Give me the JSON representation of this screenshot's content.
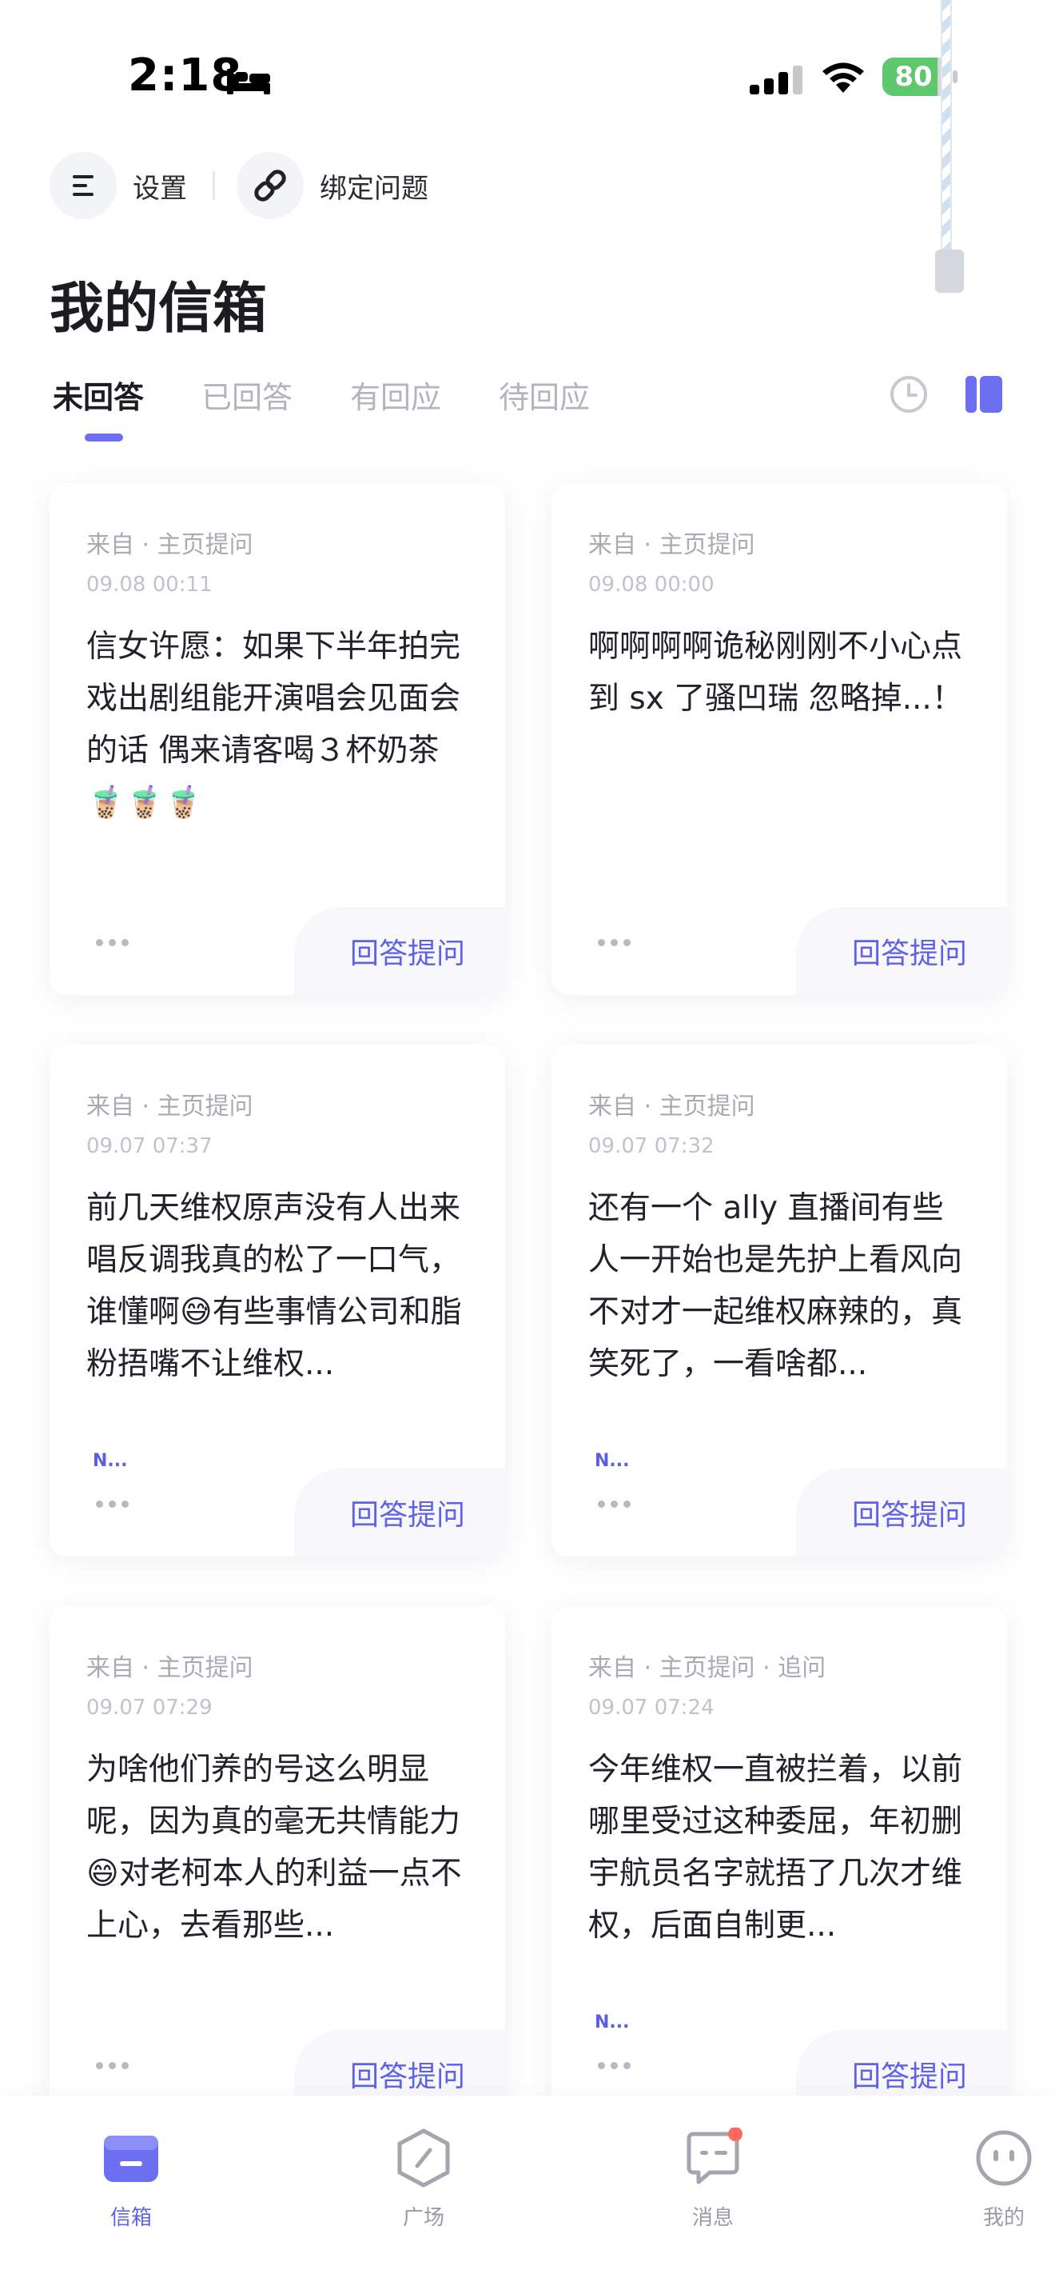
{
  "status_bar": {
    "time": "2:18",
    "battery": "80",
    "battery_level": 0.8
  },
  "header": {
    "settings_label": "设置",
    "bind_label": "绑定问题",
    "title": "我的信箱"
  },
  "tabs": [
    {
      "label": "未回答",
      "active": true
    },
    {
      "label": "已回答",
      "active": false
    },
    {
      "label": "有回应",
      "active": false
    },
    {
      "label": "待回应",
      "active": false
    }
  ],
  "colors": {
    "accent": "#5e62e6",
    "tab_underline": "#6b6ff0",
    "battery_green": "#5fc76e",
    "badge_red": "#ff6a5c"
  },
  "cards": [
    {
      "source": "来自 · 主页提问",
      "time": "09.08 00:11",
      "text": "信女许愿：如果下半年拍完戏出剧组能开演唱会见面会的话 偶来请客喝３杯奶茶🧋🧋🧋",
      "tag": "",
      "answer_label": "回答提问"
    },
    {
      "source": "来自 · 主页提问",
      "time": "09.08 00:00",
      "text": "啊啊啊啊诡秘刚刚不小心点到 sx 了骚凹瑞 忽略掉...！",
      "tag": "",
      "answer_label": "回答提问"
    },
    {
      "source": "来自 · 主页提问",
      "time": "09.07 07:37",
      "text": "前几天维权原声没有人出来唱反调我真的松了一口气，谁懂啊😅有些事情公司和脂粉捂嘴不让维权...",
      "tag": "N...",
      "answer_label": "回答提问"
    },
    {
      "source": "来自 · 主页提问",
      "time": "09.07 07:32",
      "text": "还有一个 ally 直播间有些人一开始也是先护上看风向不对才一起维权麻辣的，真笑死了，一看啥都...",
      "tag": "N...",
      "answer_label": "回答提问"
    },
    {
      "source": "来自 · 主页提问",
      "time": "09.07 07:29",
      "text": "为啥他们养的号这么明显呢，因为真的毫无共情能力😄对老柯本人的利益一点不上心，去看那些...",
      "tag": "",
      "answer_label": "回答提问"
    },
    {
      "source": "来自 · 主页提问 · 追问",
      "time": "09.07 07:24",
      "text": "今年维权一直被拦着，以前哪里受过这种委屈，年初删宇航员名字就捂了几次才维权，后面自制更...",
      "tag": "N...",
      "answer_label": "回答提问"
    }
  ],
  "bottom_nav": [
    {
      "label": "信箱",
      "icon": "mailbox-icon",
      "active": true
    },
    {
      "label": "广场",
      "icon": "compass-icon",
      "active": false
    },
    {
      "label": "消息",
      "icon": "chat-icon",
      "active": false,
      "badge": true
    },
    {
      "label": "我的",
      "icon": "face-icon",
      "active": false
    }
  ]
}
